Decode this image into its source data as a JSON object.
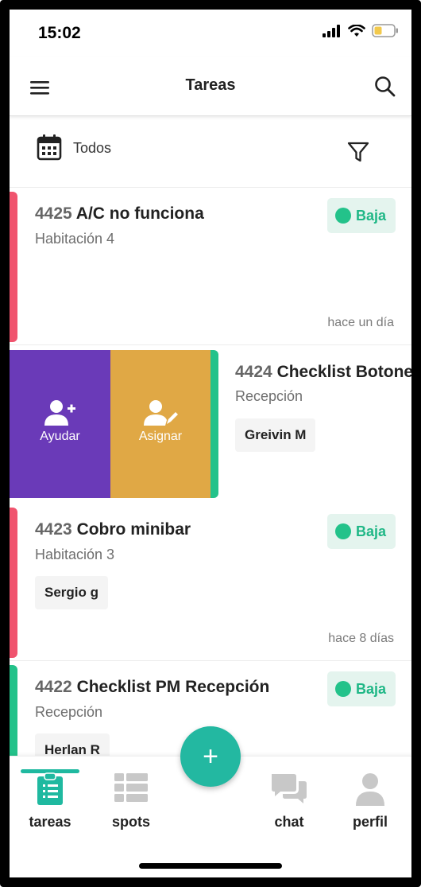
{
  "status_bar": {
    "time": "15:02"
  },
  "app_bar": {
    "title": "Tareas"
  },
  "filter": {
    "label": "Todos"
  },
  "tasks": [
    {
      "number": "4425",
      "title": "A/C no funciona",
      "location": "Habitación 4",
      "priority": "Baja",
      "ago": "hace un día",
      "stripe_color": "#f0546e"
    },
    {
      "number": "4424",
      "title": "Checklist Botones",
      "location": "Recepción",
      "assignee": "Greivin M",
      "stripe_color": "#23c28a"
    },
    {
      "number": "4423",
      "title": "Cobro minibar",
      "location": "Habitación 3",
      "priority": "Baja",
      "assignee": "Sergio g",
      "ago": "hace 8 días",
      "stripe_color": "#f0546e"
    },
    {
      "number": "4422",
      "title": "Checklist PM Recepción",
      "location": "Recepción",
      "priority": "Baja",
      "assignee": "Herlan R",
      "stripe_color": "#23c28a"
    }
  ],
  "swipe_actions": {
    "help": "Ayudar",
    "assign": "Asignar"
  },
  "fab": {
    "label": "+"
  },
  "nav": {
    "tareas": "tareas",
    "spots": "spots",
    "chat": "chat",
    "perfil": "perfil"
  },
  "colors": {
    "accent": "#1fb9a0",
    "help": "#6a3ab8",
    "assign": "#e0a845",
    "priority_low": "#1fb786"
  }
}
